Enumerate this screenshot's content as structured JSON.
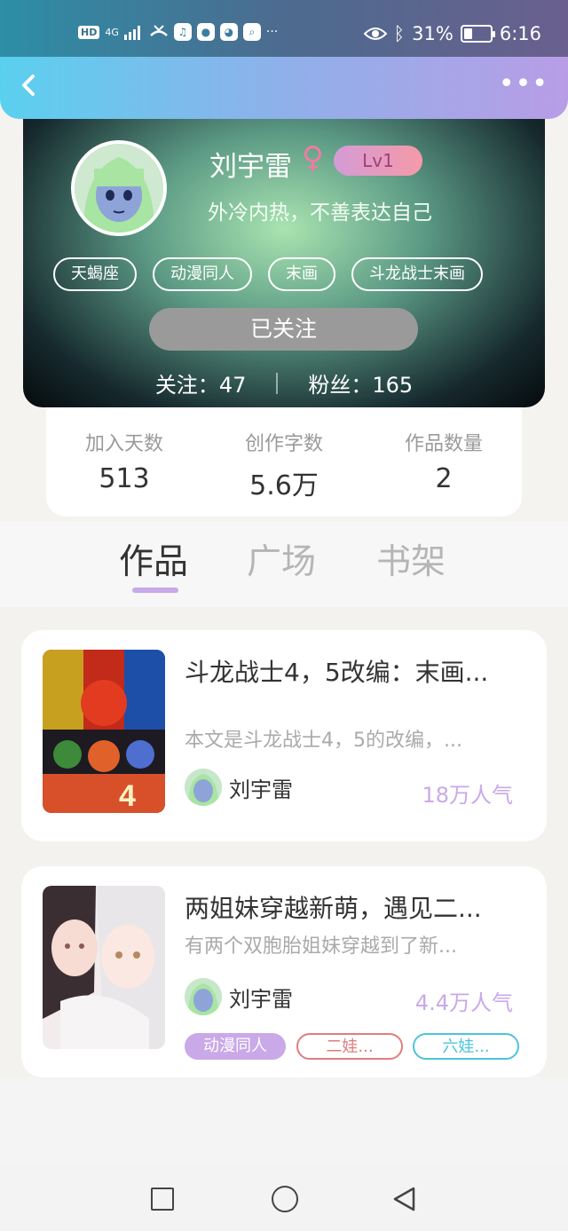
{
  "status_bar": {
    "hd": "HD",
    "network": "4G",
    "battery": "31%",
    "battery_level": 0.31,
    "time": "6:16",
    "icons": [
      "hd-icon",
      "signal-icon",
      "missed-call-icon",
      "music-icon",
      "chat-icon",
      "wechat-icon",
      "search-app-icon",
      "more-dots-icon",
      "eye-icon",
      "bluetooth-icon",
      "battery-icon"
    ]
  },
  "nav": {
    "back_icon": "chevron-left-icon",
    "more_icon": "more-dots-icon"
  },
  "profile": {
    "name": "刘宇雷",
    "gender_symbol": "♀",
    "level": "Lv1",
    "bio": "外冷内热，不善表达自己",
    "tags": [
      "天蝎座",
      "动漫同人",
      "末画",
      "斗龙战士末画"
    ],
    "follow_button": "已关注",
    "following_label": "关注：",
    "following": "47",
    "fans_label": "粉丝：",
    "fans": "165"
  },
  "stats": [
    {
      "label": "加入天数",
      "value": "513"
    },
    {
      "label": "创作字数",
      "value": "5.6万"
    },
    {
      "label": "作品数量",
      "value": "2"
    }
  ],
  "tabs": [
    {
      "label": "作品",
      "active": true
    },
    {
      "label": "广场",
      "active": false
    },
    {
      "label": "书架",
      "active": false
    }
  ],
  "works": [
    {
      "title": "斗龙战士4，5改编：末画...",
      "desc": "本文是斗龙战士4，5的改编，...",
      "author": "刘宇雷",
      "popularity": "18万人气",
      "tags": []
    },
    {
      "title": "两姐妹穿越新萌，遇见二...",
      "desc": "有两个双胞胎姐妹穿越到了新...",
      "author": "刘宇雷",
      "popularity": "4.4万人气",
      "tags": [
        {
          "label": "动漫同人",
          "color": "#c9a9e8",
          "style": "filled"
        },
        {
          "label": "二娃...",
          "color": "#e07d7d",
          "style": "outline"
        },
        {
          "label": "六娃...",
          "color": "#4dc3dd",
          "style": "outline"
        }
      ]
    }
  ],
  "system_nav": {
    "items": [
      "recent-apps-icon",
      "home-icon",
      "back-icon"
    ]
  }
}
